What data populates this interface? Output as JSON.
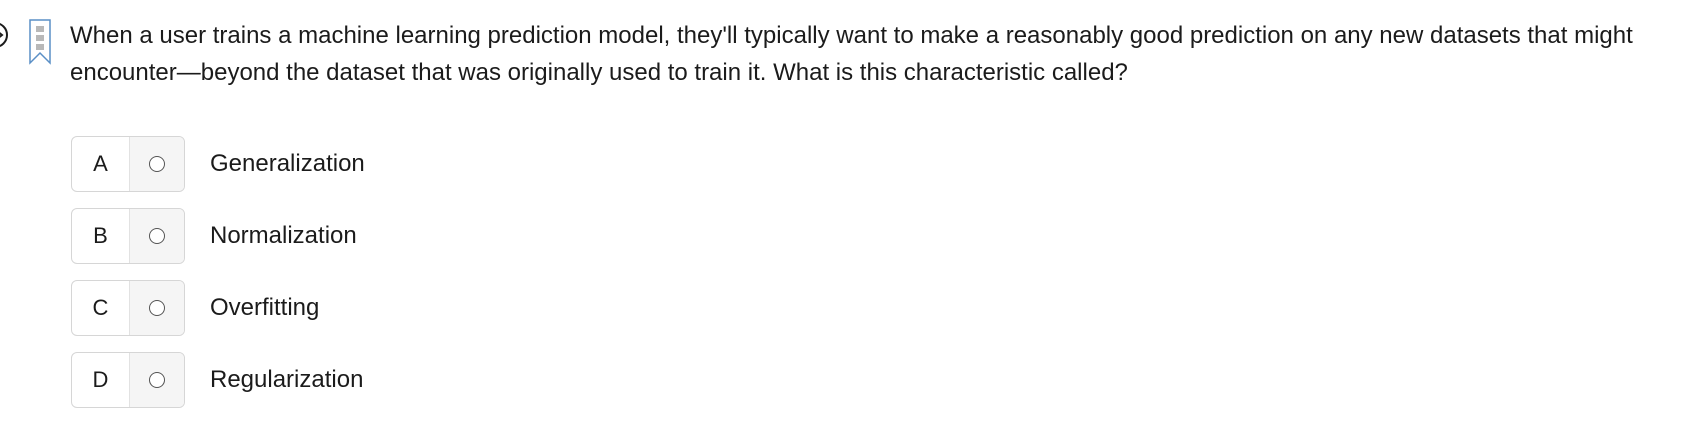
{
  "question": {
    "text": "When a user trains a machine learning prediction model, they'll typically want to make a reasonably good prediction on any new datasets that might encounter—beyond the dataset that was originally used to train it. What is this characteristic called?"
  },
  "options": [
    {
      "letter": "A",
      "label": "Generalization",
      "selected": false
    },
    {
      "letter": "B",
      "label": "Normalization",
      "selected": false
    },
    {
      "letter": "C",
      "label": "Overfitting",
      "selected": false
    },
    {
      "letter": "D",
      "label": "Regularization",
      "selected": false
    }
  ],
  "icons": {
    "nav": "arrow-right-circle-icon",
    "bookmark": "bookmark-icon"
  },
  "colors": {
    "text": "#1b1b1b",
    "border": "#d6d6d6",
    "radio_cell_bg": "#f5f5f5",
    "bookmark_fill": "#b8b8b8",
    "bookmark_stroke": "#5a8fc6"
  }
}
